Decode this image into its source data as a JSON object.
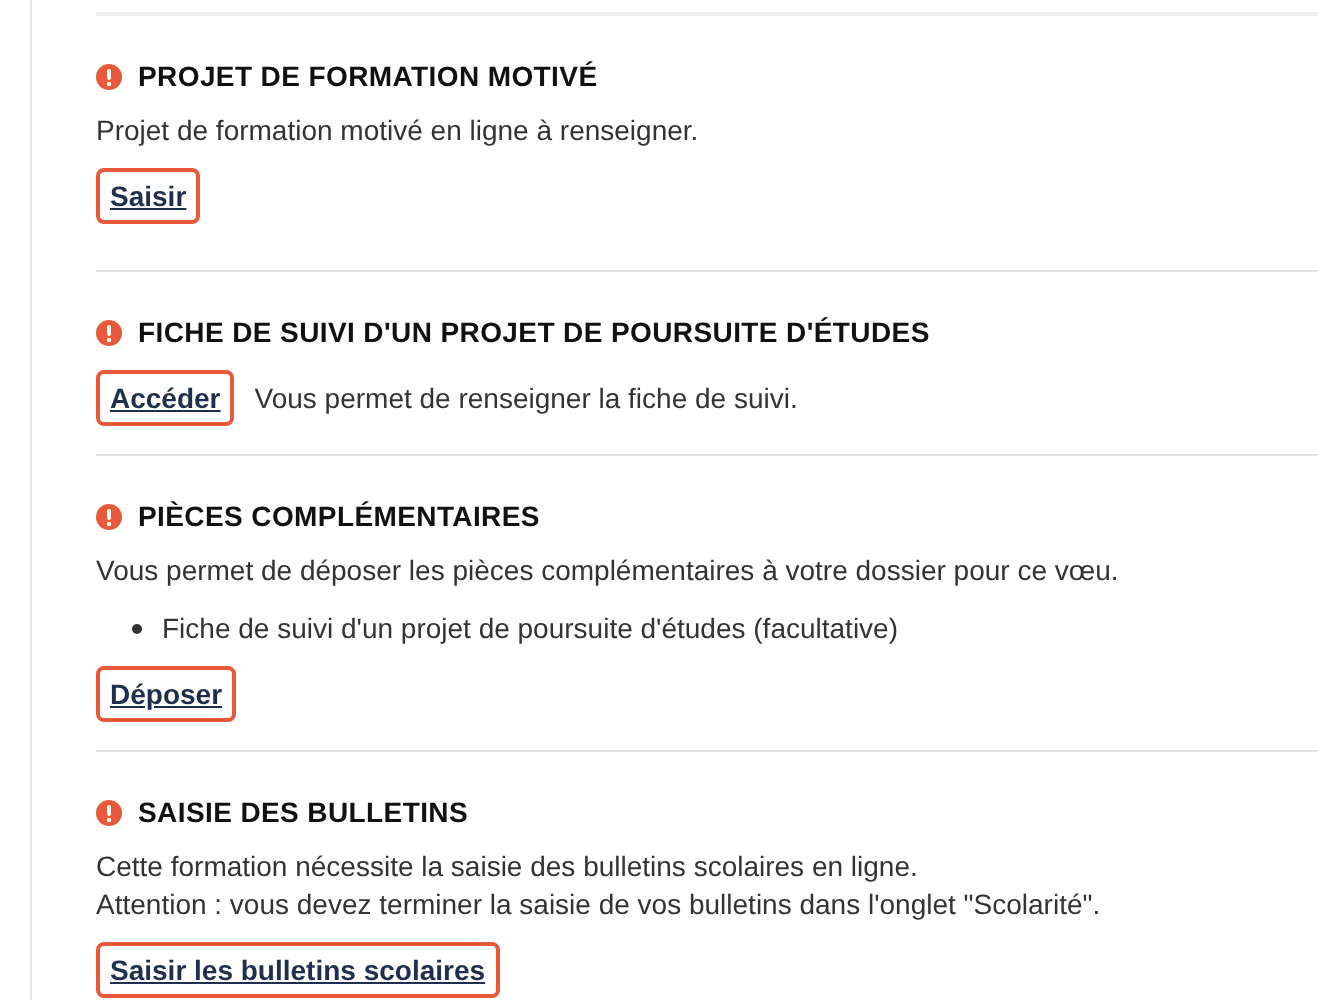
{
  "sections": [
    {
      "title": "PROJET DE FORMATION MOTIVÉ",
      "alert": true,
      "blocks": [
        {
          "kind": "paragraph",
          "lines": [
            "Projet de formation motivé en ligne à renseigner."
          ]
        },
        {
          "kind": "action",
          "label": "Saisir"
        }
      ]
    },
    {
      "title": "FICHE DE SUIVI D'UN PROJET DE POURSUITE D'ÉTUDES",
      "alert": true,
      "blocks": [
        {
          "kind": "action",
          "label": "Accéder",
          "note": "Vous permet de renseigner la fiche de suivi."
        }
      ]
    },
    {
      "title": "PIÈCES COMPLÉMENTAIRES",
      "alert": true,
      "blocks": [
        {
          "kind": "paragraph",
          "lines": [
            "Vous permet de déposer les pièces complémentaires à votre dossier pour ce vœu."
          ]
        },
        {
          "kind": "bullets",
          "items": [
            "Fiche de suivi d'un projet de poursuite d'études (facultative)"
          ]
        },
        {
          "kind": "action",
          "label": "Déposer"
        }
      ]
    },
    {
      "title": "SAISIE DES BULLETINS",
      "alert": true,
      "blocks": [
        {
          "kind": "paragraph",
          "lines": [
            "Cette formation nécessite la saisie des bulletins scolaires en ligne.",
            "Attention : vous devez terminer la saisie de vos bulletins dans l'onglet \"Scolarité\"."
          ]
        },
        {
          "kind": "action",
          "label": "Saisir les bulletins scolaires"
        }
      ]
    }
  ]
}
